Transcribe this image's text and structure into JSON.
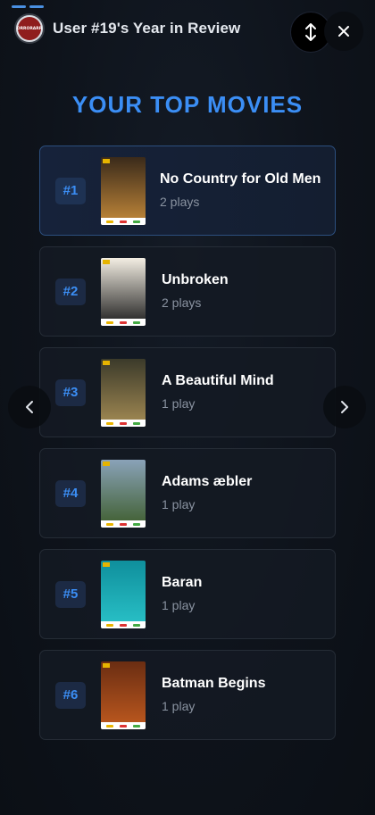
{
  "header": {
    "title": "User #19's Year in Review",
    "avatar_text": "ORRORARR",
    "expand_icon": "vertical-arrows-icon",
    "close_icon": "close-icon"
  },
  "progress": {
    "segments": 2,
    "active": 2
  },
  "section": {
    "title": "YOUR TOP MOVIES"
  },
  "movies": [
    {
      "rank": "#1",
      "title": "No Country for Old Men",
      "plays": "2 plays",
      "poster_colors": [
        "#3a2a1a",
        "#c58a3a"
      ]
    },
    {
      "rank": "#2",
      "title": "Unbroken",
      "plays": "2 plays",
      "poster_colors": [
        "#f3eee3",
        "#1b1b1b"
      ]
    },
    {
      "rank": "#3",
      "title": "A Beautiful Mind",
      "plays": "1 play",
      "poster_colors": [
        "#3b3a2a",
        "#a58c54"
      ]
    },
    {
      "rank": "#4",
      "title": "Adams æbler",
      "plays": "1 play",
      "poster_colors": [
        "#8aa2b8",
        "#3e5d2c"
      ]
    },
    {
      "rank": "#5",
      "title": "Baran",
      "plays": "1 play",
      "poster_colors": [
        "#0f8f9c",
        "#2ac3c9"
      ]
    },
    {
      "rank": "#6",
      "title": "Batman Begins",
      "plays": "1 play",
      "poster_colors": [
        "#6a2d12",
        "#c05a1f"
      ]
    }
  ],
  "nav": {
    "prev_icon": "chevron-left-icon",
    "next_icon": "chevron-right-icon"
  },
  "colors": {
    "accent": "#3b8ef5",
    "background": "#0d1117"
  }
}
